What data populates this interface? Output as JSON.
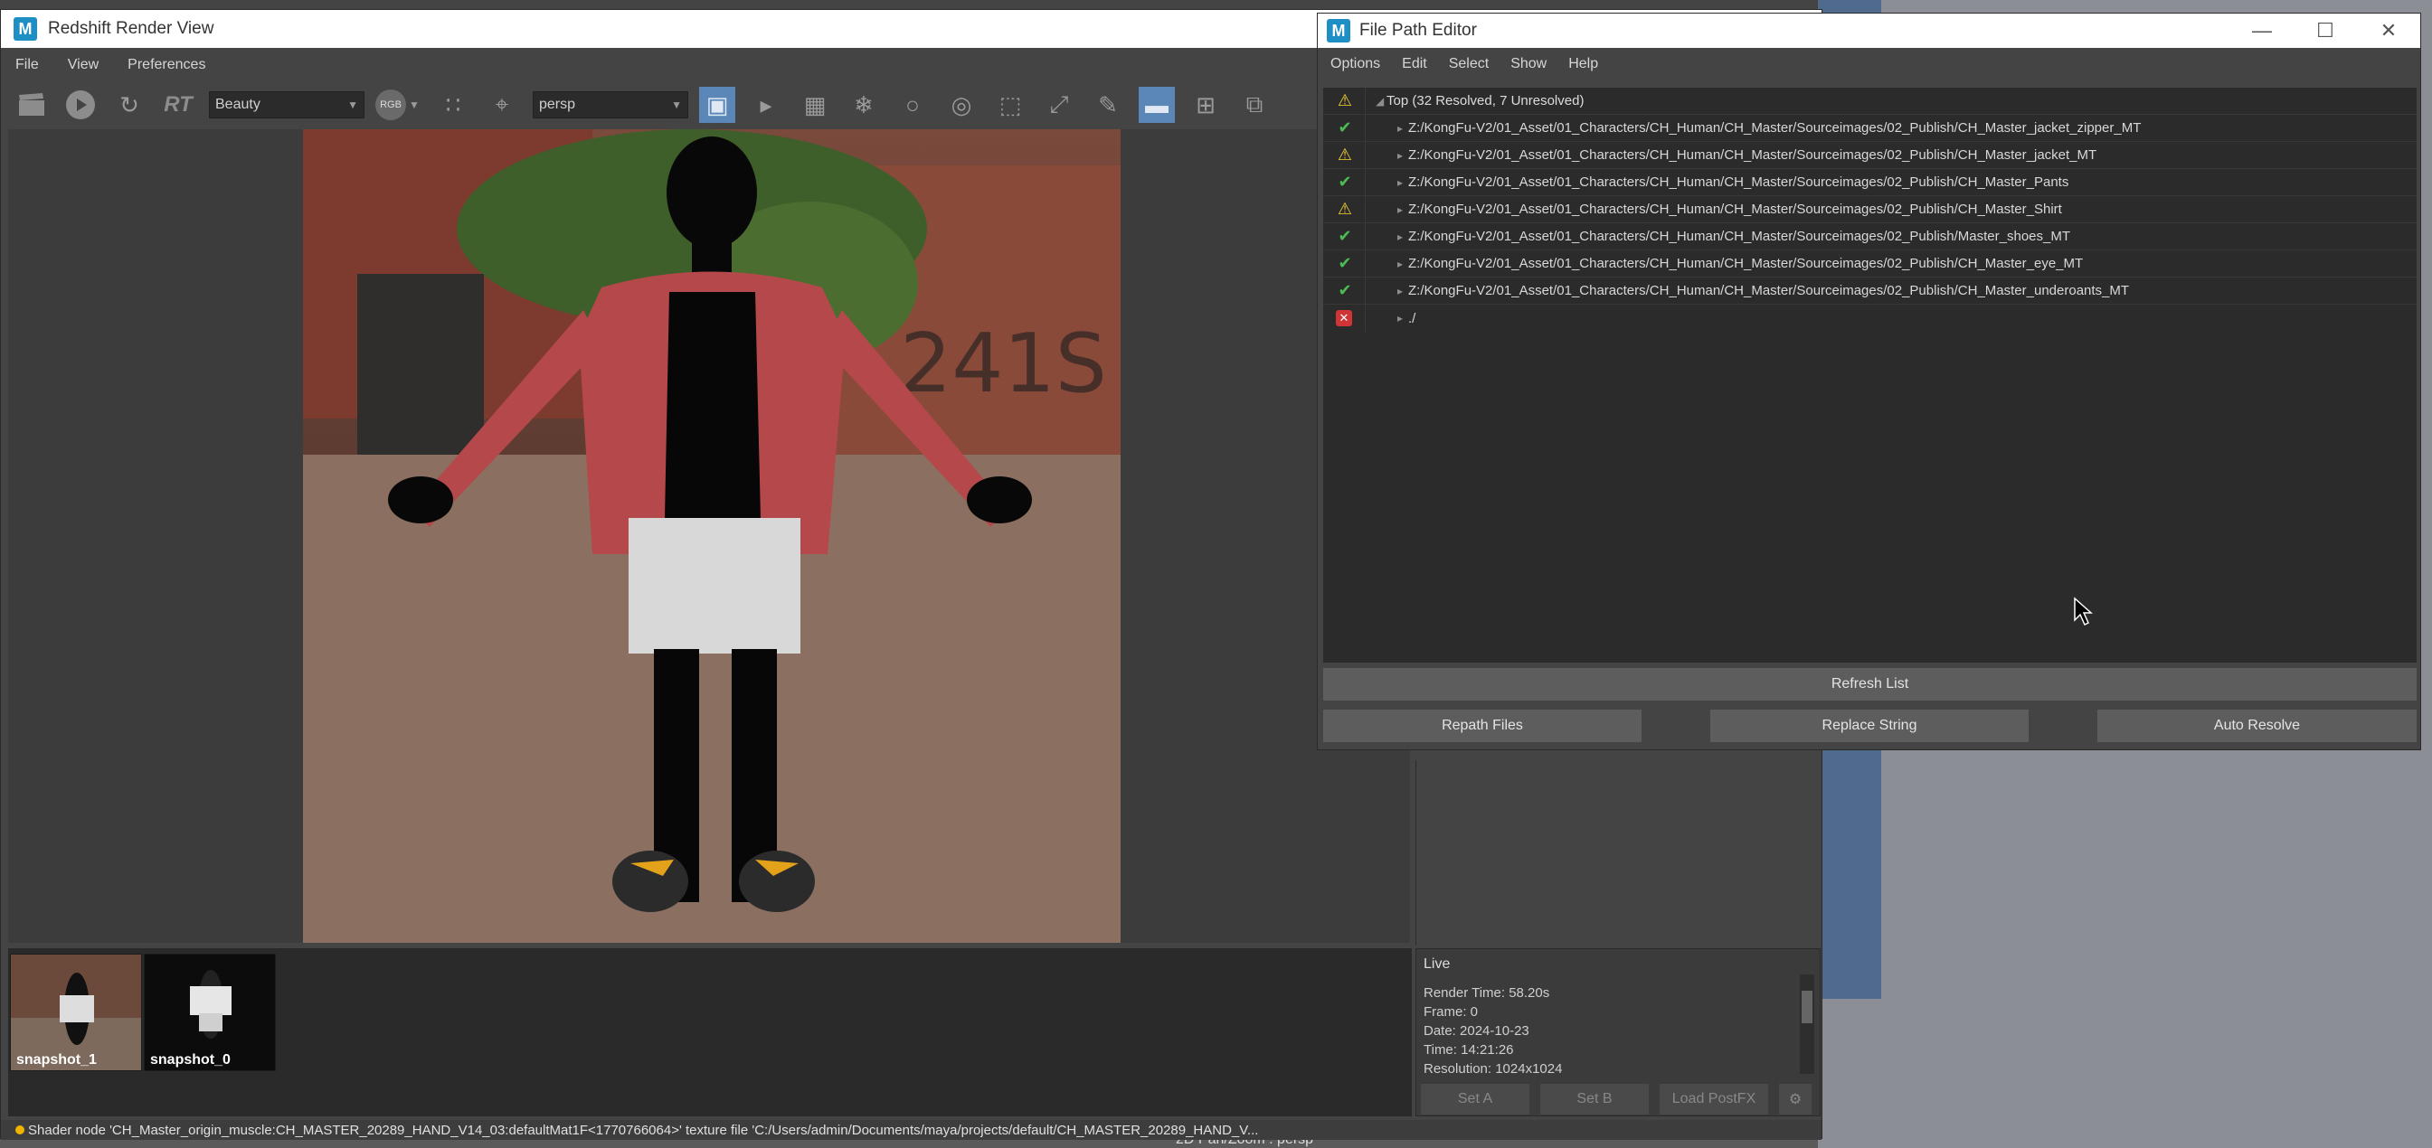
{
  "redshift": {
    "title": "Redshift Render View",
    "app_logo": "M",
    "menu": [
      "File",
      "View",
      "Preferences"
    ],
    "toolbar": {
      "aov_value": "Beauty",
      "rt_label": "RT",
      "rgb_label": "RGB",
      "camera_value": "persp"
    },
    "snapshots": [
      {
        "label": "snapshot_1"
      },
      {
        "label": "snapshot_0"
      }
    ],
    "info": {
      "title": "Live",
      "render_time": "Render Time: 58.20s",
      "frame": "Frame: 0",
      "date": "Date: 2024-10-23",
      "time": "Time: 14:21:26",
      "resolution": "Resolution: 1024x1024"
    },
    "buttons": {
      "set_a": "Set A",
      "set_b": "Set B",
      "load_postfx": "Load PostFX"
    },
    "status": "Shader node 'CH_Master_origin_muscle:CH_MASTER_20289_HAND_V14_03:defaultMat1F<1770766064>' texture file 'C:/Users/admin/Documents/maya/projects/default/CH_MASTER_20289_HAND_V..."
  },
  "fpe": {
    "title": "File Path Editor",
    "app_logo": "M",
    "menu": [
      "Options",
      "Edit",
      "Select",
      "Show",
      "Help"
    ],
    "top_row": "Top (32 Resolved, 7 Unresolved)",
    "rows": [
      {
        "status": "ok",
        "path": "Z:/KongFu-V2/01_Asset/01_Characters/CH_Human/CH_Master/Sourceimages/02_Publish/CH_Master_jacket_zipper_MT"
      },
      {
        "status": "warn",
        "path": "Z:/KongFu-V2/01_Asset/01_Characters/CH_Human/CH_Master/Sourceimages/02_Publish/CH_Master_jacket_MT"
      },
      {
        "status": "ok",
        "path": "Z:/KongFu-V2/01_Asset/01_Characters/CH_Human/CH_Master/Sourceimages/02_Publish/CH_Master_Pants"
      },
      {
        "status": "warn",
        "path": "Z:/KongFu-V2/01_Asset/01_Characters/CH_Human/CH_Master/Sourceimages/02_Publish/CH_Master_Shirt"
      },
      {
        "status": "ok",
        "path": "Z:/KongFu-V2/01_Asset/01_Characters/CH_Human/CH_Master/Sourceimages/02_Publish/Master_shoes_MT"
      },
      {
        "status": "ok",
        "path": "Z:/KongFu-V2/01_Asset/01_Characters/CH_Human/CH_Master/Sourceimages/02_Publish/CH_Master_eye_MT"
      },
      {
        "status": "ok",
        "path": "Z:/KongFu-V2/01_Asset/01_Characters/CH_Human/CH_Master/Sourceimages/02_Publish/CH_Master_underoants_MT"
      },
      {
        "status": "error",
        "path": "./"
      }
    ],
    "buttons": {
      "refresh": "Refresh List",
      "repath": "Repath Files",
      "replace": "Replace String",
      "auto_resolve": "Auto Resolve"
    }
  },
  "background": {
    "bottom_label": "2D Pan/Zoom : persp"
  },
  "icons": {
    "status_ok": "checkmark-icon",
    "status_warn": "warning-icon",
    "status_error": "error-icon"
  },
  "colors": {
    "accent_blue": "#5a87b8",
    "ok_green": "#4dbb53",
    "warn_yellow": "#f6d132",
    "error_red": "#d03434",
    "logo_blue": "#1d8fc4"
  }
}
